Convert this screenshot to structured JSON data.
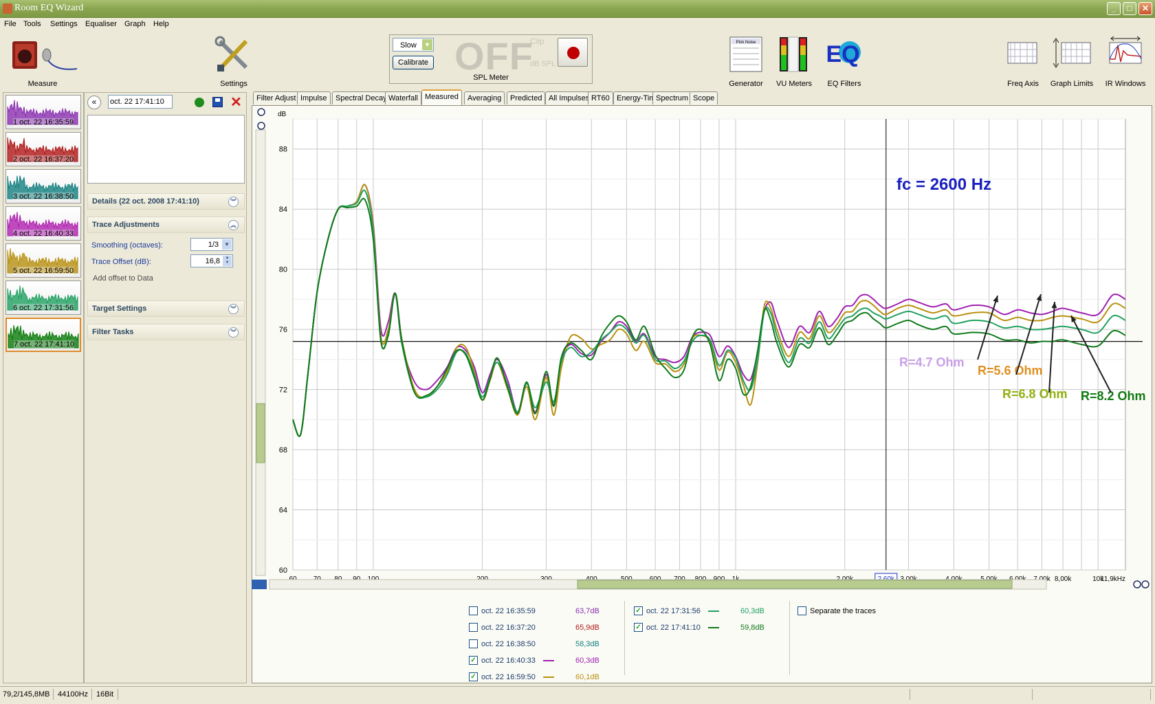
{
  "window": {
    "title": "Room EQ Wizard",
    "buttons": [
      "_",
      "□",
      "✕"
    ]
  },
  "menu": [
    "File",
    "Tools",
    "Settings",
    "Equaliser",
    "Graph",
    "Help"
  ],
  "toolbar": {
    "measure": "Measure",
    "settings": "Settings",
    "generator": "Generator",
    "vu_meters": "VU Meters",
    "eq_filters": "EQ Filters",
    "freq_axis": "Freq Axis",
    "graph_limits": "Graph Limits",
    "ir_windows": "IR Windows",
    "eq_logo": "EQ",
    "pink_noise": "Pink Noise"
  },
  "spl_meter": {
    "speed": "Slow",
    "calibrate": "Calibrate",
    "reading": "OFF",
    "clip": "Clip",
    "unit": "dB SPL",
    "label": "SPL Meter"
  },
  "measurements": [
    {
      "label": "1 oct. 22 16:35:59",
      "color": "#8a2fb0"
    },
    {
      "label": "2 oct. 22 16:37:20",
      "color": "#b01818"
    },
    {
      "label": "3 oct. 22 16:38:50",
      "color": "#148080"
    },
    {
      "label": "4 oct. 22 16:40:33",
      "color": "#b020b0"
    },
    {
      "label": "5 oct. 22 16:59:50",
      "color": "#b89010"
    },
    {
      "label": "6 oct. 22 17:31:56",
      "color": "#20a060"
    },
    {
      "label": "7 oct. 22 17:41:10",
      "color": "#0a7a0a"
    }
  ],
  "panel": {
    "name_value": "oct. 22 17:41:10",
    "details": "Details  (22 oct. 2008 17:41:10)",
    "trace_adjustments": "Trace Adjustments",
    "smoothing_label": "Smoothing (octaves):",
    "smoothing_value": "1/3",
    "offset_label": "Trace Offset (dB):",
    "offset_value": "16,8",
    "add_offset": "Add offset to Data",
    "target_settings": "Target Settings",
    "filter_tasks": "Filter Tasks"
  },
  "tabs": [
    "Filter Adjust",
    "Impulse",
    "Spectral Decay",
    "Waterfall",
    "Measured",
    "Averaging",
    "Predicted",
    "All Impulses",
    "RT60",
    "Energy-Time",
    "Spectrum",
    "Scope"
  ],
  "active_tab": "Measured",
  "chart_data": {
    "type": "line",
    "ylabel": "dB",
    "ylim": [
      60,
      90
    ],
    "xlim": [
      60,
      11900
    ],
    "xscale": "log",
    "yticks": [
      "60",
      "64",
      "68",
      "72",
      "76",
      "80",
      "84",
      "88"
    ],
    "xticks": [
      {
        "f": 60,
        "t": "60"
      },
      {
        "f": 70,
        "t": "70"
      },
      {
        "f": 80,
        "t": "80"
      },
      {
        "f": 90,
        "t": "90"
      },
      {
        "f": 100,
        "t": "100"
      },
      {
        "f": 200,
        "t": "200"
      },
      {
        "f": 300,
        "t": "300"
      },
      {
        "f": 400,
        "t": "400"
      },
      {
        "f": 500,
        "t": "500"
      },
      {
        "f": 600,
        "t": "600"
      },
      {
        "f": 700,
        "t": "700"
      },
      {
        "f": 800,
        "t": "800"
      },
      {
        "f": 900,
        "t": "900"
      },
      {
        "f": 1000,
        "t": "1k"
      },
      {
        "f": 2000,
        "t": "2,00k"
      },
      {
        "f": 3000,
        "t": "3,00k"
      },
      {
        "f": 4000,
        "t": "4,00k"
      },
      {
        "f": 5000,
        "t": "5,00k"
      },
      {
        "f": 6000,
        "t": "6,00k"
      },
      {
        "f": 7000,
        "t": "7,00k"
      },
      {
        "f": 8000,
        "t": "8,00k"
      },
      {
        "f": 10000,
        "t": "10k"
      },
      {
        "f": 11900,
        "t": "11,9kHz"
      }
    ],
    "cursor": {
      "f": 2600,
      "label": "2,60k"
    },
    "target_level": 75.2,
    "grid": true,
    "annotation": "fc = 2600 Hz",
    "labels": [
      {
        "text": "R=4.7 Ohm",
        "color": "#c8a0e8"
      },
      {
        "text": "R=5.6 Ohm",
        "color": "#e09020"
      },
      {
        "text": "R=6.8 Ohm",
        "color": "#90b010"
      },
      {
        "text": "R=8.2 Ohm",
        "color": "#107a10"
      }
    ],
    "x": [
      60,
      63,
      66,
      70,
      75,
      80,
      85,
      90,
      95,
      100,
      105,
      110,
      115,
      120,
      130,
      140,
      150,
      160,
      170,
      180,
      190,
      200,
      210,
      220,
      235,
      250,
      265,
      280,
      300,
      315,
      330,
      350,
      375,
      400,
      425,
      450,
      475,
      500,
      530,
      560,
      600,
      640,
      680,
      720,
      760,
      800,
      850,
      900,
      950,
      1000,
      1050,
      1100,
      1150,
      1200,
      1250,
      1300,
      1400,
      1500,
      1600,
      1700,
      1800,
      1900,
      2000,
      2100,
      2200,
      2300,
      2400,
      2500,
      2600,
      2800,
      3000,
      3200,
      3500,
      3800,
      4000,
      4500,
      5000,
      5500,
      6000,
      6500,
      7000,
      7500,
      8000,
      9000,
      10000,
      11000,
      11900
    ],
    "series": [
      {
        "name": "oct. 22 16:40:33",
        "color": "#a020b0",
        "values": [
          70,
          69,
          73,
          78.5,
          82,
          84,
          84.2,
          84.5,
          85.6,
          83,
          76,
          76.5,
          78.4,
          75,
          72.5,
          72,
          72.6,
          73.5,
          74.8,
          74.6,
          73.5,
          71.8,
          73,
          74,
          72.6,
          70.5,
          72.5,
          70.5,
          73,
          71,
          74,
          75,
          74.4,
          74.3,
          75.2,
          75.8,
          76.5,
          76.2,
          75.2,
          75.7,
          74.2,
          74,
          73.8,
          74.2,
          75.5,
          75.8,
          75.6,
          74.2,
          74.9,
          74.2,
          73,
          72.7,
          74.5,
          77.2,
          77.8,
          76.6,
          74.8,
          76.2,
          75.8,
          77.2,
          76.2,
          76.7,
          77.5,
          77.6,
          78.2,
          78.3,
          78.0,
          77.6,
          77.4,
          77.7,
          78.0,
          77.8,
          77.5,
          77.7,
          77.3,
          77.6,
          77.5,
          77.0,
          77.3,
          77.1,
          77.0,
          77.2,
          77.4,
          77.1,
          77.0,
          78.3,
          78.0
        ]
      },
      {
        "name": "oct. 22 16:59:50",
        "color": "#b89010",
        "values": [
          70,
          69,
          73,
          78.5,
          82,
          84,
          84.2,
          84.5,
          85.6,
          82.8,
          75.5,
          76,
          78.4,
          75.3,
          72,
          71.5,
          72.2,
          73.2,
          74.8,
          74.8,
          73.2,
          71.3,
          72.6,
          73.8,
          72,
          70.3,
          72.2,
          70,
          72.8,
          70.3,
          73.4,
          75.5,
          75.4,
          74.7,
          75,
          75.3,
          76,
          75.7,
          74.6,
          75.2,
          73.8,
          73.7,
          73.2,
          73.7,
          75.4,
          75.6,
          75.2,
          73.3,
          74.5,
          73.8,
          72.3,
          71,
          73.8,
          77.6,
          77.4,
          76,
          74.2,
          75.8,
          75.4,
          76.9,
          75.8,
          76.3,
          77.1,
          77.2,
          77.8,
          77.9,
          77.6,
          77.2,
          77.0,
          77.4,
          77.6,
          77.4,
          77.1,
          77.3,
          76.9,
          77.1,
          77.1,
          76.6,
          76.8,
          76.6,
          76.6,
          76.8,
          76.9,
          76.7,
          76.5,
          77.7,
          77.4
        ]
      },
      {
        "name": "oct. 22 17:31:56",
        "color": "#20a060",
        "values": [
          70,
          69,
          73,
          78.5,
          82,
          84,
          84.2,
          84.4,
          85.2,
          82.5,
          75.2,
          75.7,
          78.4,
          75,
          71.8,
          71.5,
          72,
          73,
          74.5,
          74.4,
          73,
          71.5,
          72.8,
          73.8,
          72.3,
          70.5,
          72.4,
          70.8,
          72.5,
          71.2,
          73.8,
          74.8,
          74.2,
          74.5,
          75.3,
          75.8,
          76.3,
          76,
          75.1,
          75.6,
          74.0,
          73.9,
          73.4,
          73.9,
          75.2,
          75.6,
          75.3,
          73.6,
          74.6,
          74.1,
          72.6,
          72,
          74,
          77.2,
          77.1,
          75.6,
          73.8,
          75.4,
          75.1,
          76.5,
          75.4,
          76.0,
          76.7,
          76.9,
          77.3,
          77.4,
          77.1,
          76.9,
          76.7,
          77.0,
          77.2,
          77.0,
          76.7,
          76.9,
          76.4,
          76.6,
          76.5,
          76.1,
          76.2,
          76.0,
          76.0,
          76.1,
          76.2,
          76.0,
          75.8,
          76.9,
          76.6
        ]
      },
      {
        "name": "oct. 22 17:41:10",
        "color": "#0f7a1a",
        "values": [
          70,
          69,
          73,
          78.5,
          82,
          84,
          84.1,
          84.2,
          84.6,
          82,
          75.2,
          75.6,
          78.4,
          75.2,
          71.8,
          71.6,
          72.2,
          73.4,
          74.6,
          74.3,
          72.8,
          71.3,
          72.7,
          74.1,
          72.1,
          70.4,
          72.5,
          70.4,
          73.2,
          70.9,
          74.1,
          75.1,
          74.6,
          74.0,
          75.5,
          76.4,
          76.9,
          76.5,
          75.3,
          76.2,
          74.3,
          73.4,
          72.8,
          73.3,
          75.5,
          76.0,
          75.0,
          72.6,
          74.0,
          73.4,
          71.7,
          72.2,
          74.6,
          77.3,
          76.6,
          75.1,
          73.5,
          75.0,
          74.8,
          76.1,
          75.0,
          75.6,
          76.4,
          76.6,
          77.0,
          77.1,
          76.7,
          76.4,
          76.1,
          76.4,
          76.6,
          76.3,
          76.0,
          76.2,
          75.7,
          75.8,
          75.7,
          75.3,
          75.3,
          75.1,
          75.2,
          75.2,
          75.3,
          75.0,
          74.9,
          75.9,
          75.6
        ]
      }
    ]
  },
  "legend": {
    "items": [
      {
        "label": "oct. 22 16:35:59",
        "value": "63,7dB",
        "checked": false,
        "color": "#8a2fb0"
      },
      {
        "label": "oct. 22 16:37:20",
        "value": "65,9dB",
        "checked": false,
        "color": "#b01818"
      },
      {
        "label": "oct. 22 16:38:50",
        "value": "58,3dB",
        "checked": false,
        "color": "#148080"
      },
      {
        "label": "oct. 22 16:40:33",
        "value": "60,3dB",
        "checked": true,
        "color": "#a020b0"
      },
      {
        "label": "oct. 22 16:59:50",
        "value": "60,1dB",
        "checked": true,
        "color": "#b89010"
      },
      {
        "label": "oct. 22 17:31:56",
        "value": "60,3dB",
        "checked": true,
        "color": "#20a060"
      },
      {
        "label": "oct. 22 17:41:10",
        "value": "59,8dB",
        "checked": true,
        "color": "#0f7a1a"
      }
    ],
    "separate": "Separate the traces"
  },
  "status": {
    "memory": "79,2/145,8MB",
    "rate": "44100Hz",
    "bits": "16Bit"
  }
}
